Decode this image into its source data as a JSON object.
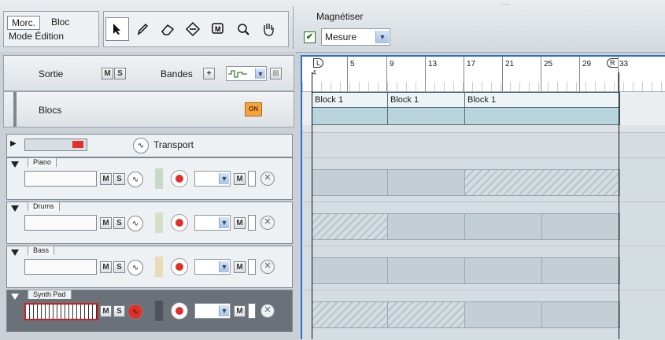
{
  "toolbar": {
    "mode_button": "Morc.",
    "mode_alt": "Bloc",
    "mode_label": "Mode Édition",
    "tools": [
      "arrow-tool-icon",
      "pencil-tool-icon",
      "eraser-tool-icon",
      "razor-tool-icon",
      "mute-tool-icon",
      "magnify-tool-icon",
      "hand-tool-icon"
    ],
    "tool_glyphs": [
      "➤",
      "✎",
      "⌫",
      "✂",
      "Ⓜ",
      "🔍",
      "✋"
    ],
    "snap_title": "Magnétiser",
    "snap_checked": "✔",
    "snap_value": "Mesure"
  },
  "header": {
    "output_label": "Sortie",
    "m": "M",
    "s": "S",
    "lanes_label": "Bandes",
    "plus": "+",
    "blocks_label": "Blocs",
    "on_badge": "ON"
  },
  "transport": {
    "label": "Transport"
  },
  "tracks": [
    {
      "name": "Piano"
    },
    {
      "name": "Drums"
    },
    {
      "name": "Bass"
    },
    {
      "name": "Synth Pad"
    }
  ],
  "ruler": {
    "loop_left": "L",
    "loop_right": "R",
    "start_sub": "4",
    "bars": [
      "5",
      "9",
      "13",
      "17",
      "21",
      "25",
      "29",
      "33"
    ]
  },
  "blocks": [
    "Block 1",
    "Block 1",
    "Block 1"
  ],
  "colors": {
    "accent": "#2e6fd0",
    "record": "#e0302a",
    "block": "#b9d4dc"
  }
}
